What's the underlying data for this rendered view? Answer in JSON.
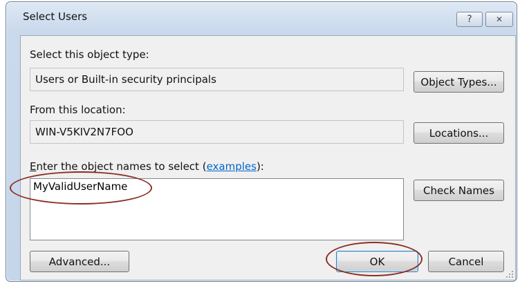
{
  "window": {
    "title": "Select Users",
    "help_glyph": "?",
    "close_glyph": "✕"
  },
  "object_type": {
    "label": "Select this object type:",
    "value": "Users or Built-in security principals",
    "button": "Object Types..."
  },
  "location": {
    "label": "From this location:",
    "value": "WIN-V5KIV2N7FOO",
    "button": "Locations..."
  },
  "names": {
    "label_first_char": "E",
    "label_rest": "nter the object names to select (",
    "link": "examples",
    "label_end": "):",
    "value": "MyValidUserName",
    "check_button": "Check Names"
  },
  "footer": {
    "advanced": "Advanced...",
    "ok": "OK",
    "cancel": "Cancel"
  },
  "annotations": {
    "color": "#8b2e25"
  }
}
